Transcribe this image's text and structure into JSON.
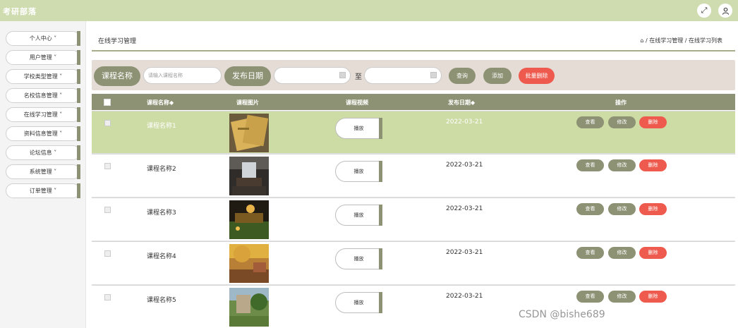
{
  "app": {
    "title": "考研部落"
  },
  "topbar": {
    "fullscreen_icon": "fullscreen-icon",
    "user_icon": "user-icon"
  },
  "sidebar": {
    "items": [
      {
        "label": "个人中心 ˅"
      },
      {
        "label": "用户管理 ˅"
      },
      {
        "label": "学校类型管理 ˅"
      },
      {
        "label": "名校信息管理 ˅"
      },
      {
        "label": "在线学习管理 ˅"
      },
      {
        "label": "资料信息管理 ˅"
      },
      {
        "label": "论坛信息 ˅"
      },
      {
        "label": "系统管理 ˅"
      },
      {
        "label": "订单管理 ˅"
      }
    ]
  },
  "header": {
    "title": "在线学习管理",
    "breadcrumb": "⌂ / 在线学习管理 / 在线学习列表"
  },
  "search": {
    "name_label": "课程名称",
    "name_placeholder": "请输入课程名称",
    "date_label": "发布日期",
    "to_text": "至",
    "query_button": "查询",
    "add_button": "添加",
    "batch_delete_button": "批量删除"
  },
  "table": {
    "columns": [
      "课程名称◆",
      "课程图片",
      "课程视频",
      "发布日期◆",
      "操作"
    ],
    "rows": [
      {
        "name": "课程名称1",
        "date": "2022-03-21",
        "play": "播放",
        "view": "查看",
        "edit": "修改",
        "delete": "删除"
      },
      {
        "name": "课程名称2",
        "date": "2022-03-21",
        "play": "播放",
        "view": "查看",
        "edit": "修改",
        "delete": "删除"
      },
      {
        "name": "课程名称3",
        "date": "2022-03-21",
        "play": "播放",
        "view": "查看",
        "edit": "修改",
        "delete": "删除"
      },
      {
        "name": "课程名称4",
        "date": "2022-03-21",
        "play": "播放",
        "view": "查看",
        "edit": "修改",
        "delete": "删除"
      },
      {
        "name": "课程名称5",
        "date": "2022-03-21",
        "play": "播放",
        "view": "查看",
        "edit": "修改",
        "delete": "删除"
      }
    ]
  },
  "colors": {
    "accent": "#8e9275",
    "topbar": "#cfdcb0",
    "selected_row": "#cddba5",
    "danger": "#ee5b4e"
  },
  "watermark": "CSDN @bishe689"
}
